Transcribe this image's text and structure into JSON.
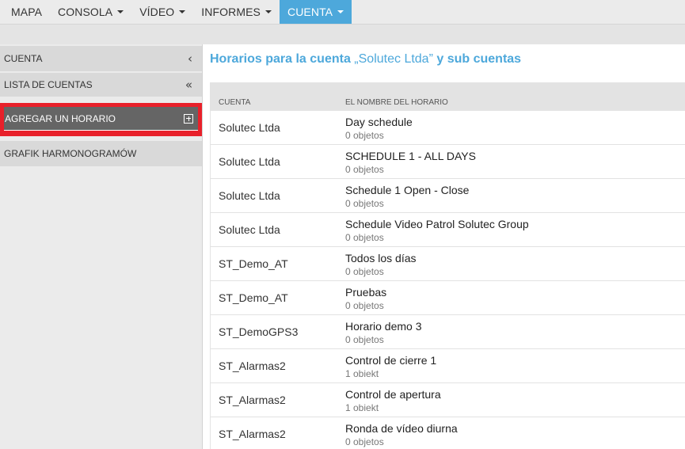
{
  "topnav": {
    "items": [
      {
        "label": "MAPA",
        "caret": false,
        "active": false
      },
      {
        "label": "CONSOLA",
        "caret": true,
        "active": false
      },
      {
        "label": "VÍDEO",
        "caret": true,
        "active": false
      },
      {
        "label": "INFORMES",
        "caret": true,
        "active": false
      },
      {
        "label": "CUENTA",
        "caret": true,
        "active": true
      }
    ],
    "accent": "#4da8db"
  },
  "sidebar": {
    "cuenta": {
      "label": "CUENTA",
      "icon": "chevron-left-icon"
    },
    "lista": {
      "label": "LISTA DE CUENTAS",
      "icon": "double-chevron-left-icon"
    },
    "agregar": {
      "label": "AGREGAR UN HORARIO",
      "icon": "plus-square-icon"
    },
    "grafik": {
      "label": "GRAFIK HARMONOGRAMÓW"
    },
    "highlight_color": "#e8202a"
  },
  "main": {
    "title_prefix": "Horarios para la cuenta",
    "title_account": "„Solutec Ltda”",
    "title_suffix": "y sub cuentas",
    "columns": {
      "account": "CUENTA",
      "name": "EL NOMBRE DEL HORARIO"
    },
    "rows": [
      {
        "account": "Solutec Ltda",
        "name": "Day schedule",
        "count": "0 objetos"
      },
      {
        "account": "Solutec Ltda",
        "name": "SCHEDULE 1 - ALL DAYS",
        "count": "0 objetos"
      },
      {
        "account": "Solutec Ltda",
        "name": "Schedule 1 Open - Close",
        "count": "0 objetos"
      },
      {
        "account": "Solutec Ltda",
        "name": "Schedule Video Patrol Solutec Group",
        "count": "0 objetos"
      },
      {
        "account": "ST_Demo_AT",
        "name": "Todos los días",
        "count": "0 objetos"
      },
      {
        "account": "ST_Demo_AT",
        "name": "Pruebas",
        "count": "0 objetos"
      },
      {
        "account": "ST_DemoGPS3",
        "name": "Horario demo 3",
        "count": "0 objetos"
      },
      {
        "account": "ST_Alarmas2",
        "name": "Control de cierre 1",
        "count": "1 obiekt"
      },
      {
        "account": "ST_Alarmas2",
        "name": "Control de apertura",
        "count": "1 obiekt"
      },
      {
        "account": "ST_Alarmas2",
        "name": "Ronda de vídeo diurna",
        "count": "0 objetos"
      }
    ]
  }
}
